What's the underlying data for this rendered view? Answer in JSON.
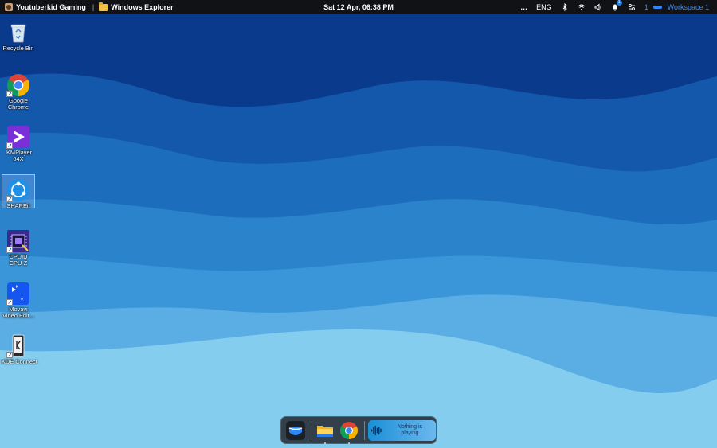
{
  "topbar": {
    "active_app": "Youtuberkid Gaming",
    "separator": "|",
    "window_title": "Windows Explorer",
    "datetime": "Sat 12 Apr, 06:38 PM",
    "more": "…",
    "language": "ENG",
    "notification_count": "1",
    "workspace_number": "1",
    "workspace_label": "Workspace 1"
  },
  "desktop": {
    "icons": [
      {
        "label": "Recycle Bin"
      },
      {
        "label": "Google Chrome"
      },
      {
        "label": "KMPlayer 64X"
      },
      {
        "label": "SHAREit"
      },
      {
        "label": "CPUID CPU-Z"
      },
      {
        "label": "Movavi Video Edit..."
      },
      {
        "label": "KDE Connect"
      }
    ]
  },
  "dock": {
    "media": {
      "line1": "Nothing is",
      "line2": "playing"
    }
  },
  "colors": {
    "accent": "#2f86f5",
    "topbar_bg": "#101216",
    "dock_bg": "#282c34"
  }
}
